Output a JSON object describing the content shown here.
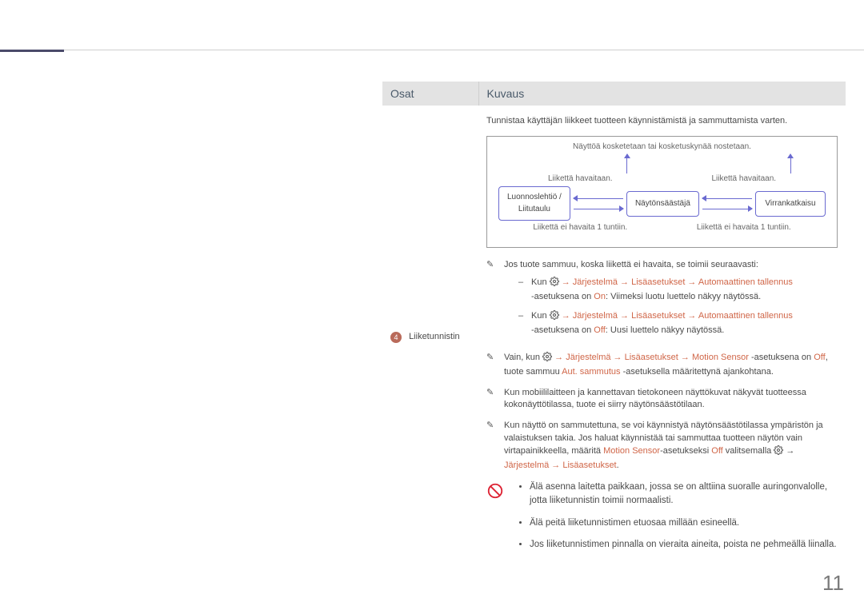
{
  "tableHeader": {
    "osat": "Osat",
    "kuvaus": "Kuvaus"
  },
  "row": {
    "num": "4",
    "name": "Liiketunnistin",
    "lead": "Tunnistaa käyttäjän liikkeet tuotteen käynnistämistä ja sammuttamista varten.",
    "diagram": {
      "top": "Näyttöä kosketetaan tai kosketuskynää nostetaan.",
      "mid_left": "Liikettä havaitaan.",
      "mid_right": "Liikettä havaitaan.",
      "bot_left": "Liikettä ei havaita 1 tuntiin.",
      "bot_right": "Liikettä ei havaita 1 tuntiin.",
      "state_a_line1": "Luonnoslehtiö /",
      "state_a_line2": "Liitutaulu",
      "state_b": "Näytönsäästäjä",
      "state_c": "Virrankatkaisu"
    },
    "notes": {
      "n1_lead": "Jos tuote sammuu, koska liikettä ei havaita, se toimii seuraavasti:",
      "n1_a_pre": "Kun ",
      "n1_a_path": "→ Järjestelmä → Lisäasetukset → Automaattinen tallennus",
      "n1_a_post_prefix": "-asetuksena on ",
      "n1_a_on": "On",
      "n1_a_post": ": Viimeksi luotu luettelo näkyy näytössä.",
      "n1_b_pre": "Kun ",
      "n1_b_path": "→ Järjestelmä → Lisäasetukset → Automaattinen tallennus",
      "n1_b_post_prefix": "-asetuksena on ",
      "n1_b_off": "Off",
      "n1_b_post": ": Uusi luettelo näkyy näytössä.",
      "n2_pre": "Vain, kun ",
      "n2_path": "→ Järjestelmä → Lisäasetukset → Motion Sensor",
      "n2_mid": " -asetuksena on ",
      "n2_off": "Off",
      "n2_post_pre": ", tuote sammuu ",
      "n2_aut": "Aut. sammutus",
      "n2_post": " -asetuksella määritettynä ajankohtana.",
      "n3": "Kun mobiililaitteen ja kannettavan tietokoneen näyttökuvat näkyvät tuotteessa kokonäyttötilassa, tuote ei siirry näytönsäästötilaan.",
      "n4_a": "Kun näyttö on sammutettuna, se voi käynnistyä näytönsäästötilassa ympäristön ja valaistuksen takia. Jos haluat käynnistää tai sammuttaa tuotteen näytön vain virtapainikkeella, määritä ",
      "n4_ms": "Motion Sensor",
      "n4_mid": "-asetukseksi ",
      "n4_off": "Off",
      "n4_post_pre": " valitsemalla ",
      "n4_path": "Järjestelmä → Lisäasetukset",
      "n4_end": "."
    },
    "warns": {
      "w1": "Älä asenna laitetta paikkaan, jossa se on alttiina suoralle auringonvalolle, jotta liiketunnistin toimii normaalisti.",
      "w2": "Älä peitä liiketunnistimen etuosaa millään esineellä.",
      "w3": "Jos liiketunnistimen pinnalla on vieraita aineita, poista ne pehmeällä liinalla."
    }
  },
  "pageNumber": "11"
}
